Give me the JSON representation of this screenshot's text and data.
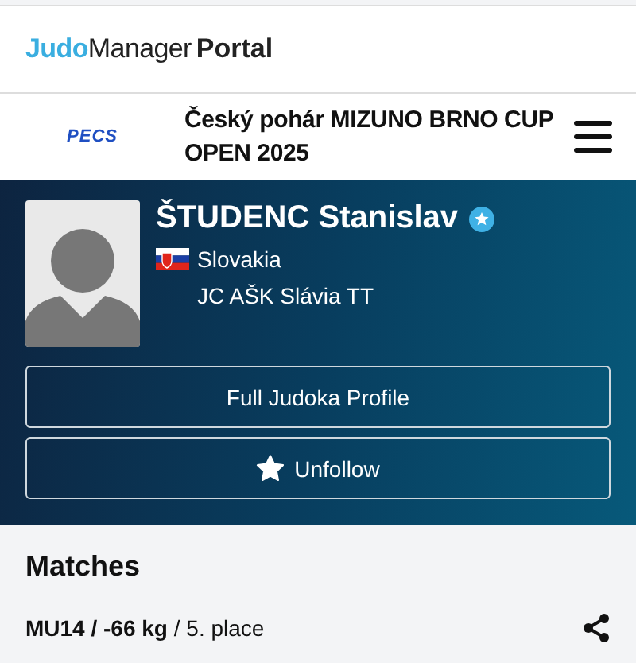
{
  "header": {
    "logo": [
      "Judo",
      "Manager",
      "Portal"
    ]
  },
  "event_bar": {
    "sponsor_logo": "PECS",
    "title": "Český pohár MIZUNO BRNO CUP OPEN 2025"
  },
  "profile": {
    "name": "ŠTUDENC Stanislav",
    "verified": true,
    "country": "Slovakia",
    "club": "JC AŠK Slávia TT",
    "buttons": [
      {
        "label": "Full Judoka Profile",
        "kind": "plain"
      },
      {
        "label": "Unfollow",
        "kind": "star"
      }
    ]
  },
  "matches": {
    "title": "Matches",
    "entry": "**MU14 / -66 kg** / 5. place"
  }
}
